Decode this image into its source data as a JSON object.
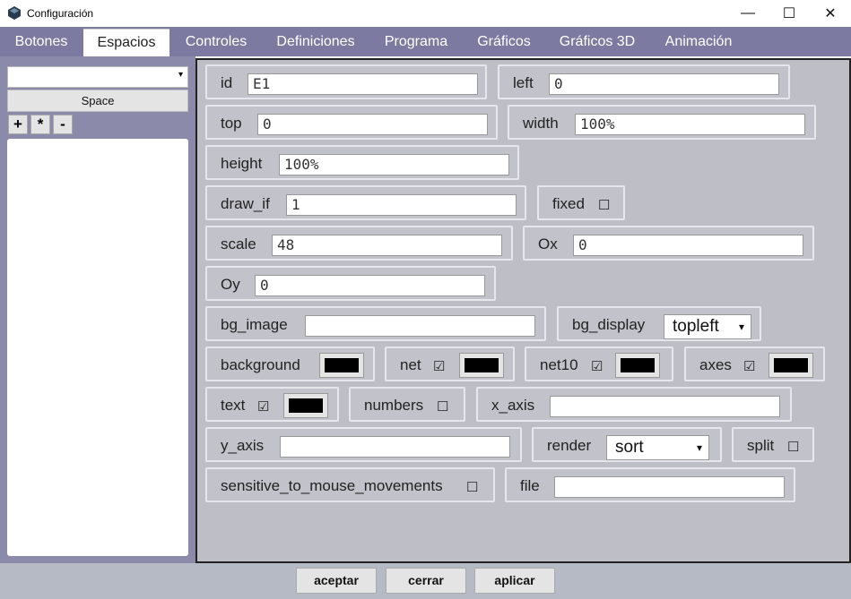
{
  "window": {
    "title": "Configuración",
    "minimize": "—",
    "maximize": "☐",
    "close": "✕"
  },
  "menu": {
    "tabs": [
      "Botones",
      "Espacios",
      "Controles",
      "Definiciones",
      "Programa",
      "Gráficos",
      "Gráficos 3D",
      "Animación"
    ],
    "active": "Espacios"
  },
  "sidebar": {
    "select_value": "",
    "select_arrow": "▾",
    "space_button": "Space",
    "add": "+",
    "dup": "*",
    "remove": "-"
  },
  "fields": {
    "id": {
      "label": "id",
      "value": "E1"
    },
    "left": {
      "label": "left",
      "value": "0"
    },
    "top": {
      "label": "top",
      "value": "0"
    },
    "width": {
      "label": "width",
      "value": "100%"
    },
    "height": {
      "label": "height",
      "value": "100%"
    },
    "draw_if": {
      "label": "draw_if",
      "value": "1"
    },
    "fixed": {
      "label": "fixed",
      "check": "☐"
    },
    "scale": {
      "label": "scale",
      "value": "48"
    },
    "ox": {
      "label": "Ox",
      "value": "0"
    },
    "oy": {
      "label": "Oy",
      "value": "0"
    },
    "bg_image": {
      "label": "bg_image",
      "value": ""
    },
    "bg_display": {
      "label": "bg_display",
      "value": "topleft",
      "arrow": "▾"
    },
    "background": {
      "label": "background",
      "color": "#000000"
    },
    "net": {
      "label": "net",
      "check": "☑",
      "color": "#000000"
    },
    "net10": {
      "label": "net10",
      "check": "☑",
      "color": "#000000"
    },
    "axes": {
      "label": "axes",
      "check": "☑",
      "color": "#000000"
    },
    "text": {
      "label": "text",
      "check": "☑",
      "color": "#000000"
    },
    "numbers": {
      "label": "numbers",
      "check": "☐"
    },
    "x_axis": {
      "label": "x_axis",
      "value": ""
    },
    "y_axis": {
      "label": "y_axis",
      "value": ""
    },
    "render": {
      "label": "render",
      "value": "sort",
      "arrow": "▾"
    },
    "split": {
      "label": "split",
      "check": "☐"
    },
    "sensitive": {
      "label": "sensitive_to_mouse_movements",
      "check": "☐"
    },
    "file": {
      "label": "file",
      "value": ""
    }
  },
  "footer": {
    "accept": "aceptar",
    "close": "cerrar",
    "apply": "aplicar"
  },
  "colors": {
    "menubar": "#7c7aa0",
    "sidebar": "#8c8aab",
    "panel": "#bebec6"
  }
}
